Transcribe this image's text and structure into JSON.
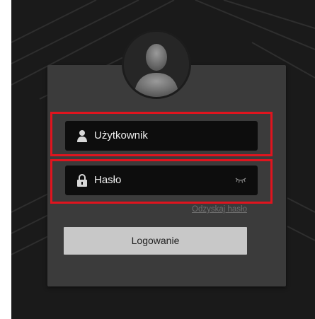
{
  "login_form": {
    "username_placeholder": "Użytkownik",
    "password_placeholder": "Hasło",
    "recover_link": "Odzyskaj hasło",
    "login_button": "Logowanie"
  },
  "colors": {
    "background": "#1a1a1a",
    "panel": "#3b3b3b",
    "field": "#0d0d0d",
    "button": "#c8c8c8",
    "highlight": "#e0141e"
  },
  "icons": {
    "avatar": "user-silhouette-icon",
    "username": "person-icon",
    "password": "lock-icon",
    "show_password": "eye-closed-icon"
  }
}
